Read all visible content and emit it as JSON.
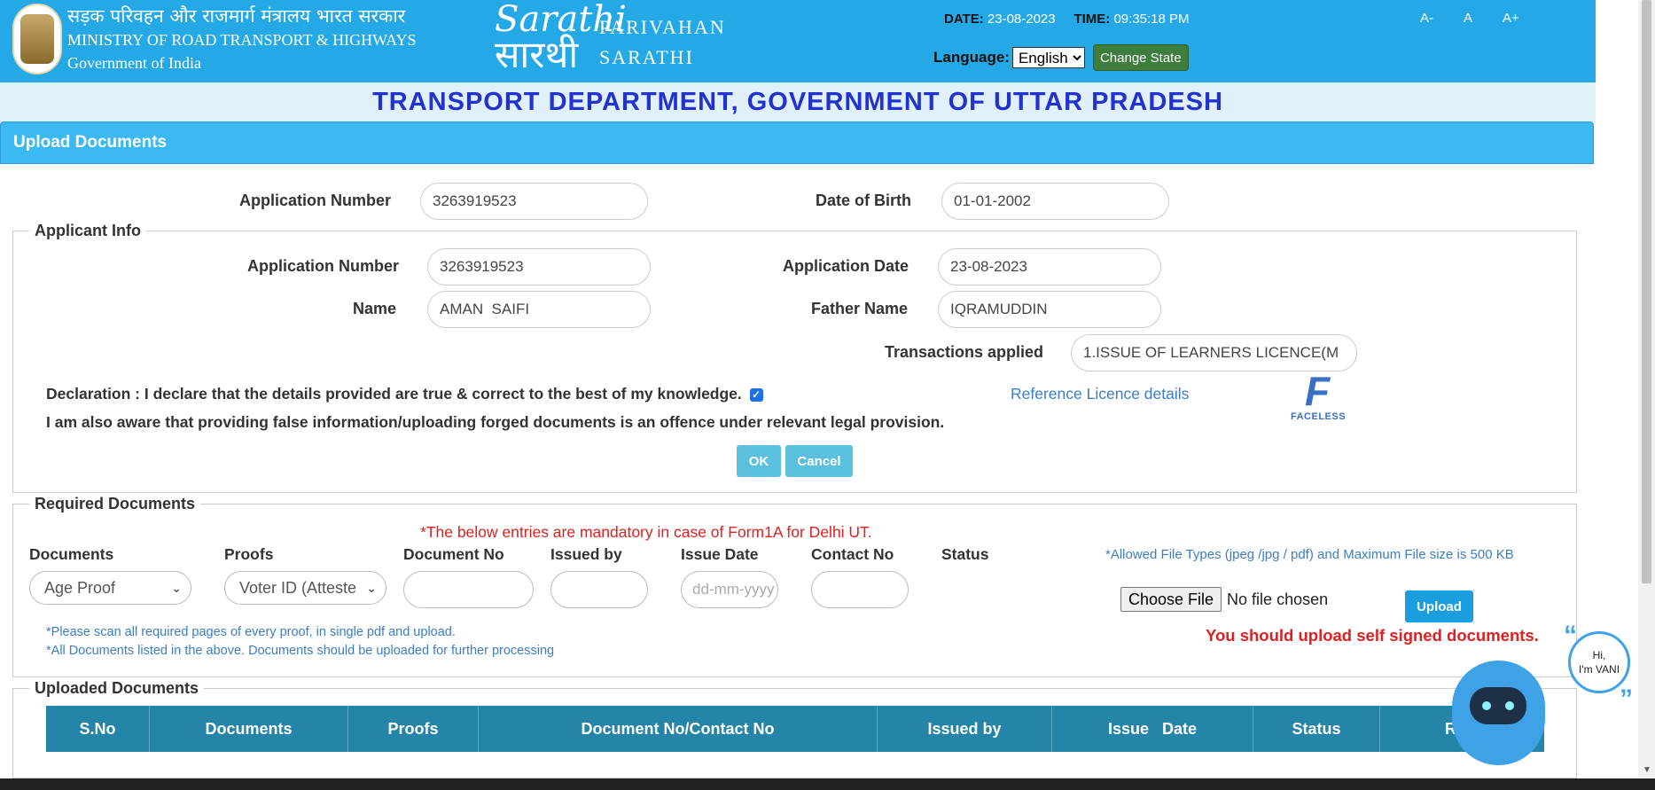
{
  "header": {
    "ministry_hi": "सड़क परिवहन और राजमार्ग मंत्रालय भारत सरकार",
    "ministry_en": "MINISTRY OF ROAD TRANSPORT & HIGHWAYS",
    "gov": "Government of India",
    "logo_line1": "Sarathi",
    "logo_line2": "सारथी",
    "brand1": "PARIVAHAN",
    "brand2": "SARATHI",
    "date_label": "DATE:",
    "date_value": "23-08-2023",
    "time_label": "TIME:",
    "time_value": "09:35:18 PM",
    "language_label": "Language:",
    "language_value": "English",
    "change_state": "Change State",
    "font_small": "A-",
    "font_normal": "A",
    "font_large": "A+"
  },
  "department": "TRANSPORT DEPARTMENT, GOVERNMENT OF UTTAR PRADESH",
  "panel_title": "Upload Documents",
  "search": {
    "app_no_label": "Application Number",
    "app_no_value": "3263919523",
    "dob_label": "Date of Birth",
    "dob_value": "01-01-2002"
  },
  "applicant": {
    "legend": "Applicant Info",
    "app_no_label": "Application Number",
    "app_no_value": "3263919523",
    "app_date_label": "Application Date",
    "app_date_value": "23-08-2023",
    "name_label": "Name",
    "name_value": "AMAN  SAIFI",
    "father_label": "Father Name",
    "father_value": "IQRAMUDDIN",
    "trans_label": "Transactions applied",
    "trans_value": "1.ISSUE OF LEARNERS LICENCE(M",
    "declaration": "Declaration : I declare that the details provided are true & correct to the best of my knowledge.",
    "awareness": "I am also aware that providing false information/uploading forged documents is an offence under relevant legal provision.",
    "ref_link": "Reference Licence details",
    "faceless_mark": "F",
    "faceless_text": "FACELESS",
    "ok": "OK",
    "cancel": "Cancel"
  },
  "required": {
    "legend": "Required Documents",
    "mandatory_note": "*The below entries are mandatory in case of Form1A for Delhi UT.",
    "columns": [
      "Documents",
      "Proofs",
      "Document No",
      "Issued by",
      "Issue Date",
      "Contact No",
      "Status"
    ],
    "allowed": "*Allowed File Types (jpeg /jpg / pdf) and Maximum File size is 500 KB",
    "documents_value": "Age Proof",
    "proofs_value": "Voter ID (Atteste",
    "issue_date_placeholder": "dd-mm-yyyy",
    "choose_file": "Choose File",
    "no_file": "No file chosen",
    "upload": "Upload",
    "self_signed": "You should upload self signed documents.",
    "note1": "*Please scan all required pages of every proof, in single pdf and upload.",
    "note2": "*All Documents listed in the above. Documents should be uploaded for further processing"
  },
  "uploaded": {
    "legend": "Uploaded Documents",
    "columns": [
      "S.No",
      "Documents",
      "Proofs",
      "Document No/Contact No",
      "Issued by",
      "Issue   Date",
      "Status",
      "Rem"
    ]
  },
  "chatbot": {
    "line1": "Hi,",
    "line2": "I'm VANI"
  }
}
